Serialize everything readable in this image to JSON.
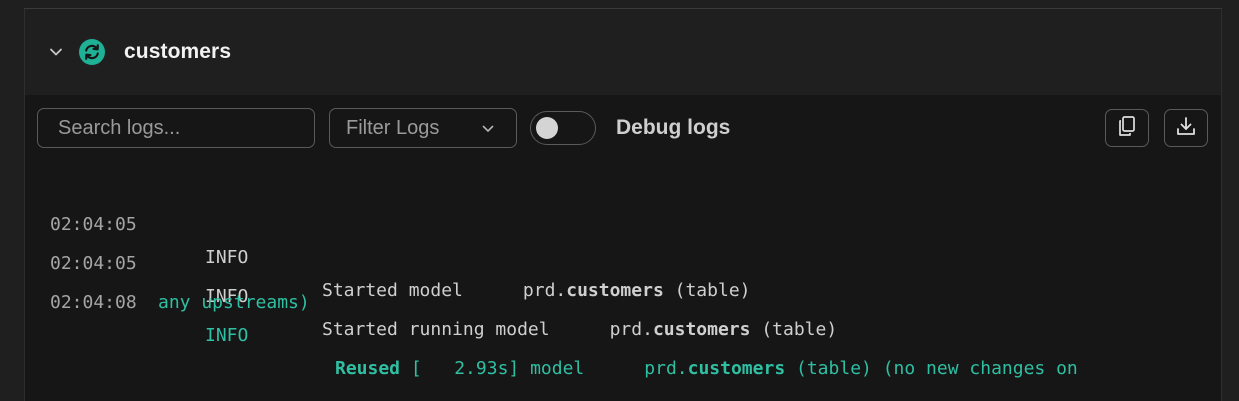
{
  "model": {
    "name": "customers",
    "status_icon": "refresh-circle-icon",
    "status_color": "#1fb195"
  },
  "toolbar": {
    "search_placeholder": "Search logs...",
    "filter_label": "Filter Logs",
    "debug_label": "Debug logs",
    "debug_enabled": false,
    "copy_icon": "copy-icon",
    "download_icon": "download-icon"
  },
  "logs": [
    {
      "time": "02:04:05",
      "level": "INFO",
      "message": "Started model",
      "target_prefix": "prd.",
      "target_name": "customers",
      "target_suffix": " (table)"
    },
    {
      "time": "02:04:05",
      "level": "INFO",
      "message": "Started running model",
      "target_prefix": "prd.",
      "target_name": "customers",
      "target_suffix": " (table)"
    },
    {
      "time": "02:04:08",
      "level": "INFO",
      "status_word": "Reused",
      "message": " [   2.93s] model",
      "target_prefix": "prd.",
      "target_name": "customers",
      "target_suffix": " (table) (no new changes on",
      "continuation": "any upstreams)"
    }
  ],
  "colors": {
    "accent": "#2fbfa3",
    "background": "#1f1f1f",
    "log_background": "#161616"
  }
}
